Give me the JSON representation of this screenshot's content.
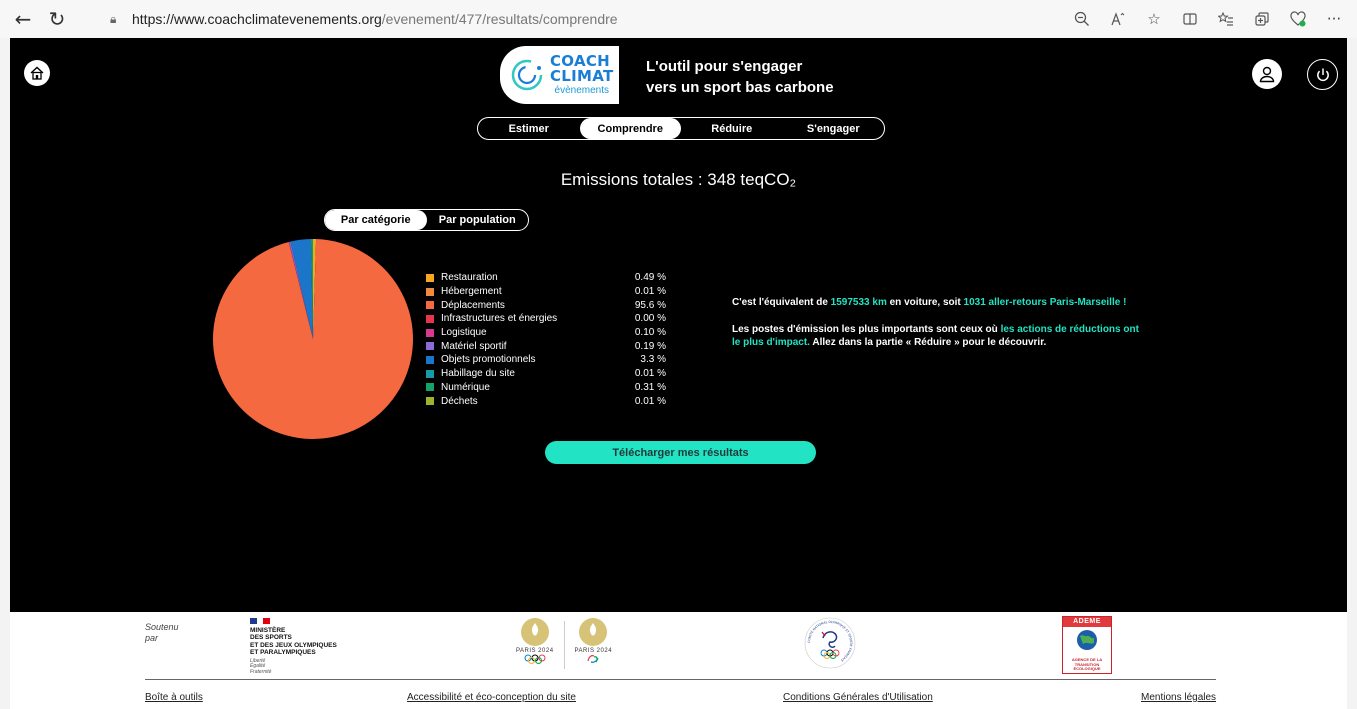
{
  "browser": {
    "url_host": "https://www.coachclimatevenements.org",
    "url_path": "/evenement/477/resultats/comprendre"
  },
  "header": {
    "logo_line1": "COACH",
    "logo_line2": "CLIMAT",
    "logo_sub": "évènements",
    "tagline_line1": "L'outil pour s'engager",
    "tagline_line2": "vers un sport bas carbone",
    "tabs": [
      {
        "label": "Estimer",
        "active": false
      },
      {
        "label": "Comprendre",
        "active": true
      },
      {
        "label": "Réduire",
        "active": false
      },
      {
        "label": "S'engager",
        "active": false
      }
    ]
  },
  "main": {
    "total_prefix": "Emissions totales : ",
    "total_value": "348",
    "total_unit": "teqCO₂",
    "subtabs": [
      {
        "label": "Par catégorie",
        "active": true
      },
      {
        "label": "Par population",
        "active": false
      }
    ],
    "download_label": "Télécharger mes résultats"
  },
  "chart_data": {
    "type": "pie",
    "categories": [
      "Restauration",
      "Hébergement",
      "Déplacements",
      "Infrastructures et énergies",
      "Logistique",
      "Matériel sportif",
      "Objets promotionnels",
      "Habillage du site",
      "Numérique",
      "Déchets"
    ],
    "values": [
      0.49,
      0.01,
      95.6,
      0.0,
      0.1,
      0.19,
      3.3,
      0.01,
      0.31,
      0.01
    ],
    "value_labels": [
      "0.49 %",
      "0.01 %",
      "95.6 %",
      "0.00 %",
      "0.10 %",
      "0.19 %",
      "3.3 %",
      "0.01 %",
      "0.31 %",
      "0.01 %"
    ],
    "colors": [
      "#f5a623",
      "#f08a3c",
      "#f4693f",
      "#e8354f",
      "#d9388e",
      "#8c6ad8",
      "#1b75c8",
      "#159aa8",
      "#13a36b",
      "#9bb52b"
    ],
    "legend": "right"
  },
  "info": {
    "p1_a": "C'est l'équivalent de ",
    "p1_km": "1597533 km",
    "p1_b": " en voiture, soit ",
    "p1_trips": "1031 aller-retours Paris-Marseille !",
    "p2_a": "Les postes d'émission les plus importants sont ceux où ",
    "p2_hl": "les actions de réductions ont le plus d'impact.",
    "p2_b": " Allez dans la partie « Réduire » pour le découvrir."
  },
  "footer": {
    "soutenu_l1": "Soutenu",
    "soutenu_l2": "par",
    "ministere": [
      "MINISTÈRE",
      "DES SPORTS",
      "ET DES JEUX OLYMPIQUES",
      "ET PARALYMPIQUES"
    ],
    "motto": [
      "Liberté",
      "Égalité",
      "Fraternité"
    ],
    "paris_label": "PARIS 2024",
    "cnosf_text": "COMITÉ NATIONAL OLYMPIQUE ET SPORTIF FRANÇAIS",
    "ademe_title": "ADEME",
    "ademe_sub": [
      "AGENCE DE LA",
      "TRANSITION",
      "ÉCOLOGIQUE"
    ],
    "links": [
      "Boîte à outils",
      "Accessibilité et éco-conception du site",
      "Conditions Générales d'Utilisation",
      "Mentions légales"
    ]
  }
}
